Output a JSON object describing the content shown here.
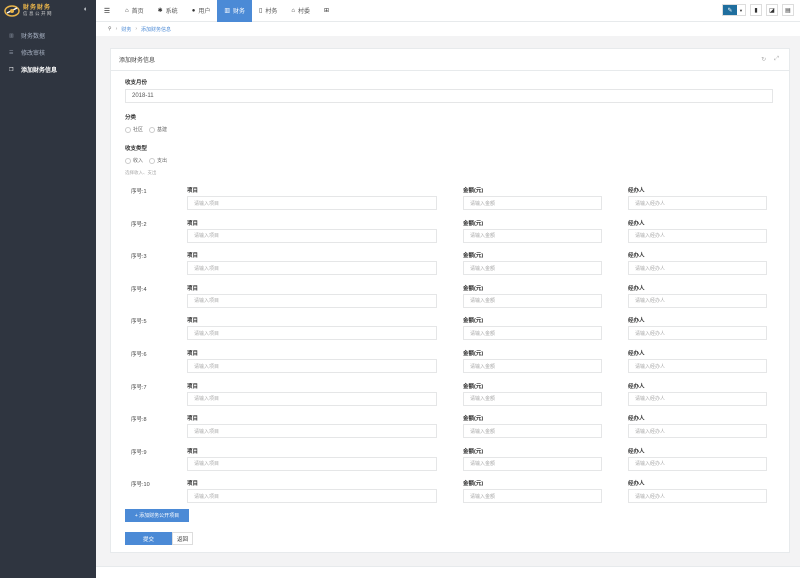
{
  "brand": {
    "line1": "财务财务",
    "line2": "信息公开网"
  },
  "sidebar": {
    "items": [
      {
        "label": "财务数据",
        "icon": "bar-chart-icon",
        "active": false
      },
      {
        "label": "修改审核",
        "icon": "list-icon",
        "active": false
      },
      {
        "label": "添加财务信息",
        "icon": "copy-icon",
        "active": true
      }
    ]
  },
  "topbar": {
    "tabs": [
      {
        "label": "首页",
        "icon": "home-icon",
        "glyph": "⌂",
        "active": false
      },
      {
        "label": "系统",
        "icon": "gear-icon",
        "glyph": "✱",
        "active": false
      },
      {
        "label": "用户",
        "icon": "user-icon",
        "glyph": "●",
        "active": false
      },
      {
        "label": "财务",
        "icon": "chart-icon",
        "glyph": "▥",
        "active": true
      },
      {
        "label": "村务",
        "icon": "file-icon",
        "glyph": "▯",
        "active": false
      },
      {
        "label": "村委",
        "icon": "home-icon",
        "glyph": "⌂",
        "active": false
      },
      {
        "label": "",
        "icon": "grid-icon",
        "glyph": "⊞",
        "active": false
      }
    ],
    "accent": "#4b8ad6"
  },
  "breadcrumb": {
    "items": [
      "财务",
      "添加财务信息"
    ]
  },
  "panel": {
    "title": "添加财务信息"
  },
  "form": {
    "month_label": "收支月份",
    "month_value": "2018-11",
    "category_label": "分类",
    "category_options": [
      "社区",
      "基建"
    ],
    "type_label": "收支类型",
    "type_options": [
      "收入",
      "支出"
    ],
    "type_hint": "选择收入、支出",
    "col_item": "项目",
    "col_amount": "金额(元)",
    "col_handler": "经办人",
    "ph_item": "请输入项目",
    "ph_amount": "请输入金额",
    "ph_handler": "请输入经办人",
    "rows": [
      "序号:1",
      "序号:2",
      "序号:3",
      "序号:4",
      "序号:5",
      "序号:6",
      "序号:7",
      "序号:8",
      "序号:9",
      "序号:10"
    ],
    "add_button": "+ 添加财务公开项目",
    "submit_button": "提交",
    "back_button": "返回"
  }
}
